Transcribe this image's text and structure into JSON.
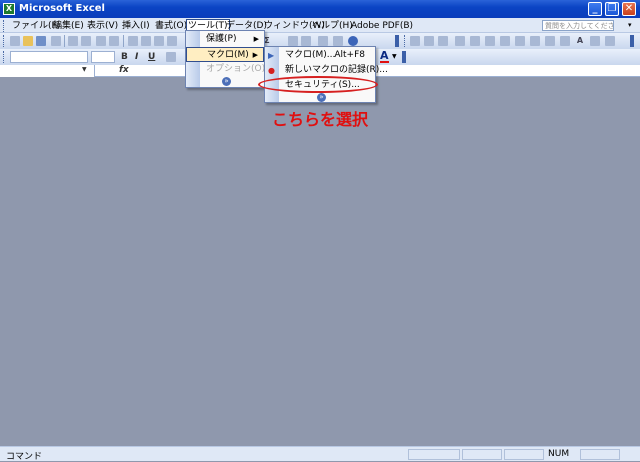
{
  "window": {
    "title": "Microsoft Excel",
    "app_icon_glyph": "X",
    "minimize_glyph": "_",
    "restore_glyph": "❐",
    "close_glyph": "✕"
  },
  "menubar": {
    "items": [
      "ファイル(F)",
      "編集(E)",
      "表示(V)",
      "挿入(I)",
      "書式(O)",
      "ツール(T)",
      "データ(D)",
      "ウィンドウ(W)",
      "ヘルプ(H)",
      "Adobe PDF(B)"
    ],
    "active": "ツール(T)",
    "help_placeholder": "質問を入力してください"
  },
  "formula_bar": {
    "fx_label": "fx"
  },
  "tools_menu": {
    "items": [
      {
        "label": "保護(P)",
        "has_submenu": true
      },
      {
        "label": "マクロ(M)",
        "has_submenu": true,
        "highlighted": true
      },
      {
        "label": "オプション(O)...",
        "disabled": true
      }
    ],
    "expand_glyph": "»"
  },
  "macro_submenu": {
    "items": [
      {
        "label": "マクロ(M)...",
        "shortcut": "Alt+F8",
        "icon": "play-icon"
      },
      {
        "label": "新しいマクロの記録(R)...",
        "icon": "record-icon"
      },
      {
        "label": "セキュリティ(S)...",
        "circled": true
      }
    ],
    "expand_glyph": "»"
  },
  "annotation": {
    "text": "こちらを選択",
    "color": "#e01010"
  },
  "statusbar": {
    "text": "コマンド",
    "num_indicator": "NUM"
  },
  "colors": {
    "titlebar": "#0a3dbb",
    "menu_highlight": "#ffeec2",
    "workspace": "#8f98ad"
  }
}
